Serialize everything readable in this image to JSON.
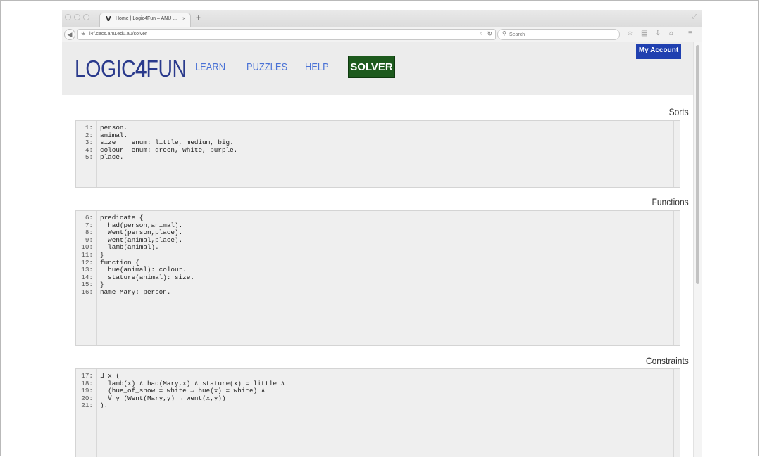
{
  "browser": {
    "tab_title": "Home | Logic4Fun – ANU ...",
    "tab_favicon": "V",
    "tab_close": "×",
    "new_tab": "+",
    "url": "l4f.cecs.anu.edu.au/solver",
    "search_placeholder": "Search",
    "icons": [
      "back-icon",
      "globe-icon",
      "reload-icon",
      "search-icon",
      "star-icon",
      "library-icon",
      "download-icon",
      "home-icon",
      "menu-icon"
    ]
  },
  "header": {
    "logo_part1": "LOGIC",
    "logo_part2": "4",
    "logo_part3": "FUN",
    "nav": {
      "learn": "LEARN",
      "puzzles": "PUZZLES",
      "help": "HELP",
      "solver": "SOLVER"
    },
    "account": "My Account"
  },
  "colors": {
    "logo": "#2a3a8c",
    "nav_link": "#4a72d6",
    "solver_bg": "#1d5a1d",
    "account_bg": "#2040b0"
  },
  "sections": {
    "sorts": {
      "title": "Sorts",
      "lines": [
        {
          "n": "1:",
          "t": "person."
        },
        {
          "n": "2:",
          "t": "animal."
        },
        {
          "n": "3:",
          "t": "size    enum: little, medium, big."
        },
        {
          "n": "4:",
          "t": "colour  enum: green, white, purple."
        },
        {
          "n": "5:",
          "t": "place."
        }
      ]
    },
    "functions": {
      "title": "Functions",
      "lines": [
        {
          "n": "6:",
          "t": "predicate {"
        },
        {
          "n": "7:",
          "t": "  had(person,animal)."
        },
        {
          "n": "8:",
          "t": "  Went(person,place)."
        },
        {
          "n": "9:",
          "t": "  went(animal,place)."
        },
        {
          "n": "10:",
          "t": "  lamb(animal)."
        },
        {
          "n": "11:",
          "t": "}"
        },
        {
          "n": "12:",
          "t": "function {"
        },
        {
          "n": "13:",
          "t": "  hue(animal): colour."
        },
        {
          "n": "14:",
          "t": "  stature(animal): size."
        },
        {
          "n": "15:",
          "t": "}"
        },
        {
          "n": "16:",
          "t": "name Mary: person."
        }
      ]
    },
    "constraints": {
      "title": "Constraints",
      "lines": [
        {
          "n": "17:",
          "t": "∃ x ("
        },
        {
          "n": "18:",
          "t": "  lamb(x) ∧ had(Mary,x) ∧ stature(x) = little ∧"
        },
        {
          "n": "19:",
          "t": "  (hue_of_snow = white → hue(x) = white) ∧"
        },
        {
          "n": "20:",
          "t": "  ∀ y (Went(Mary,y) → went(x,y))"
        },
        {
          "n": "21:",
          "t": ")."
        }
      ]
    }
  }
}
